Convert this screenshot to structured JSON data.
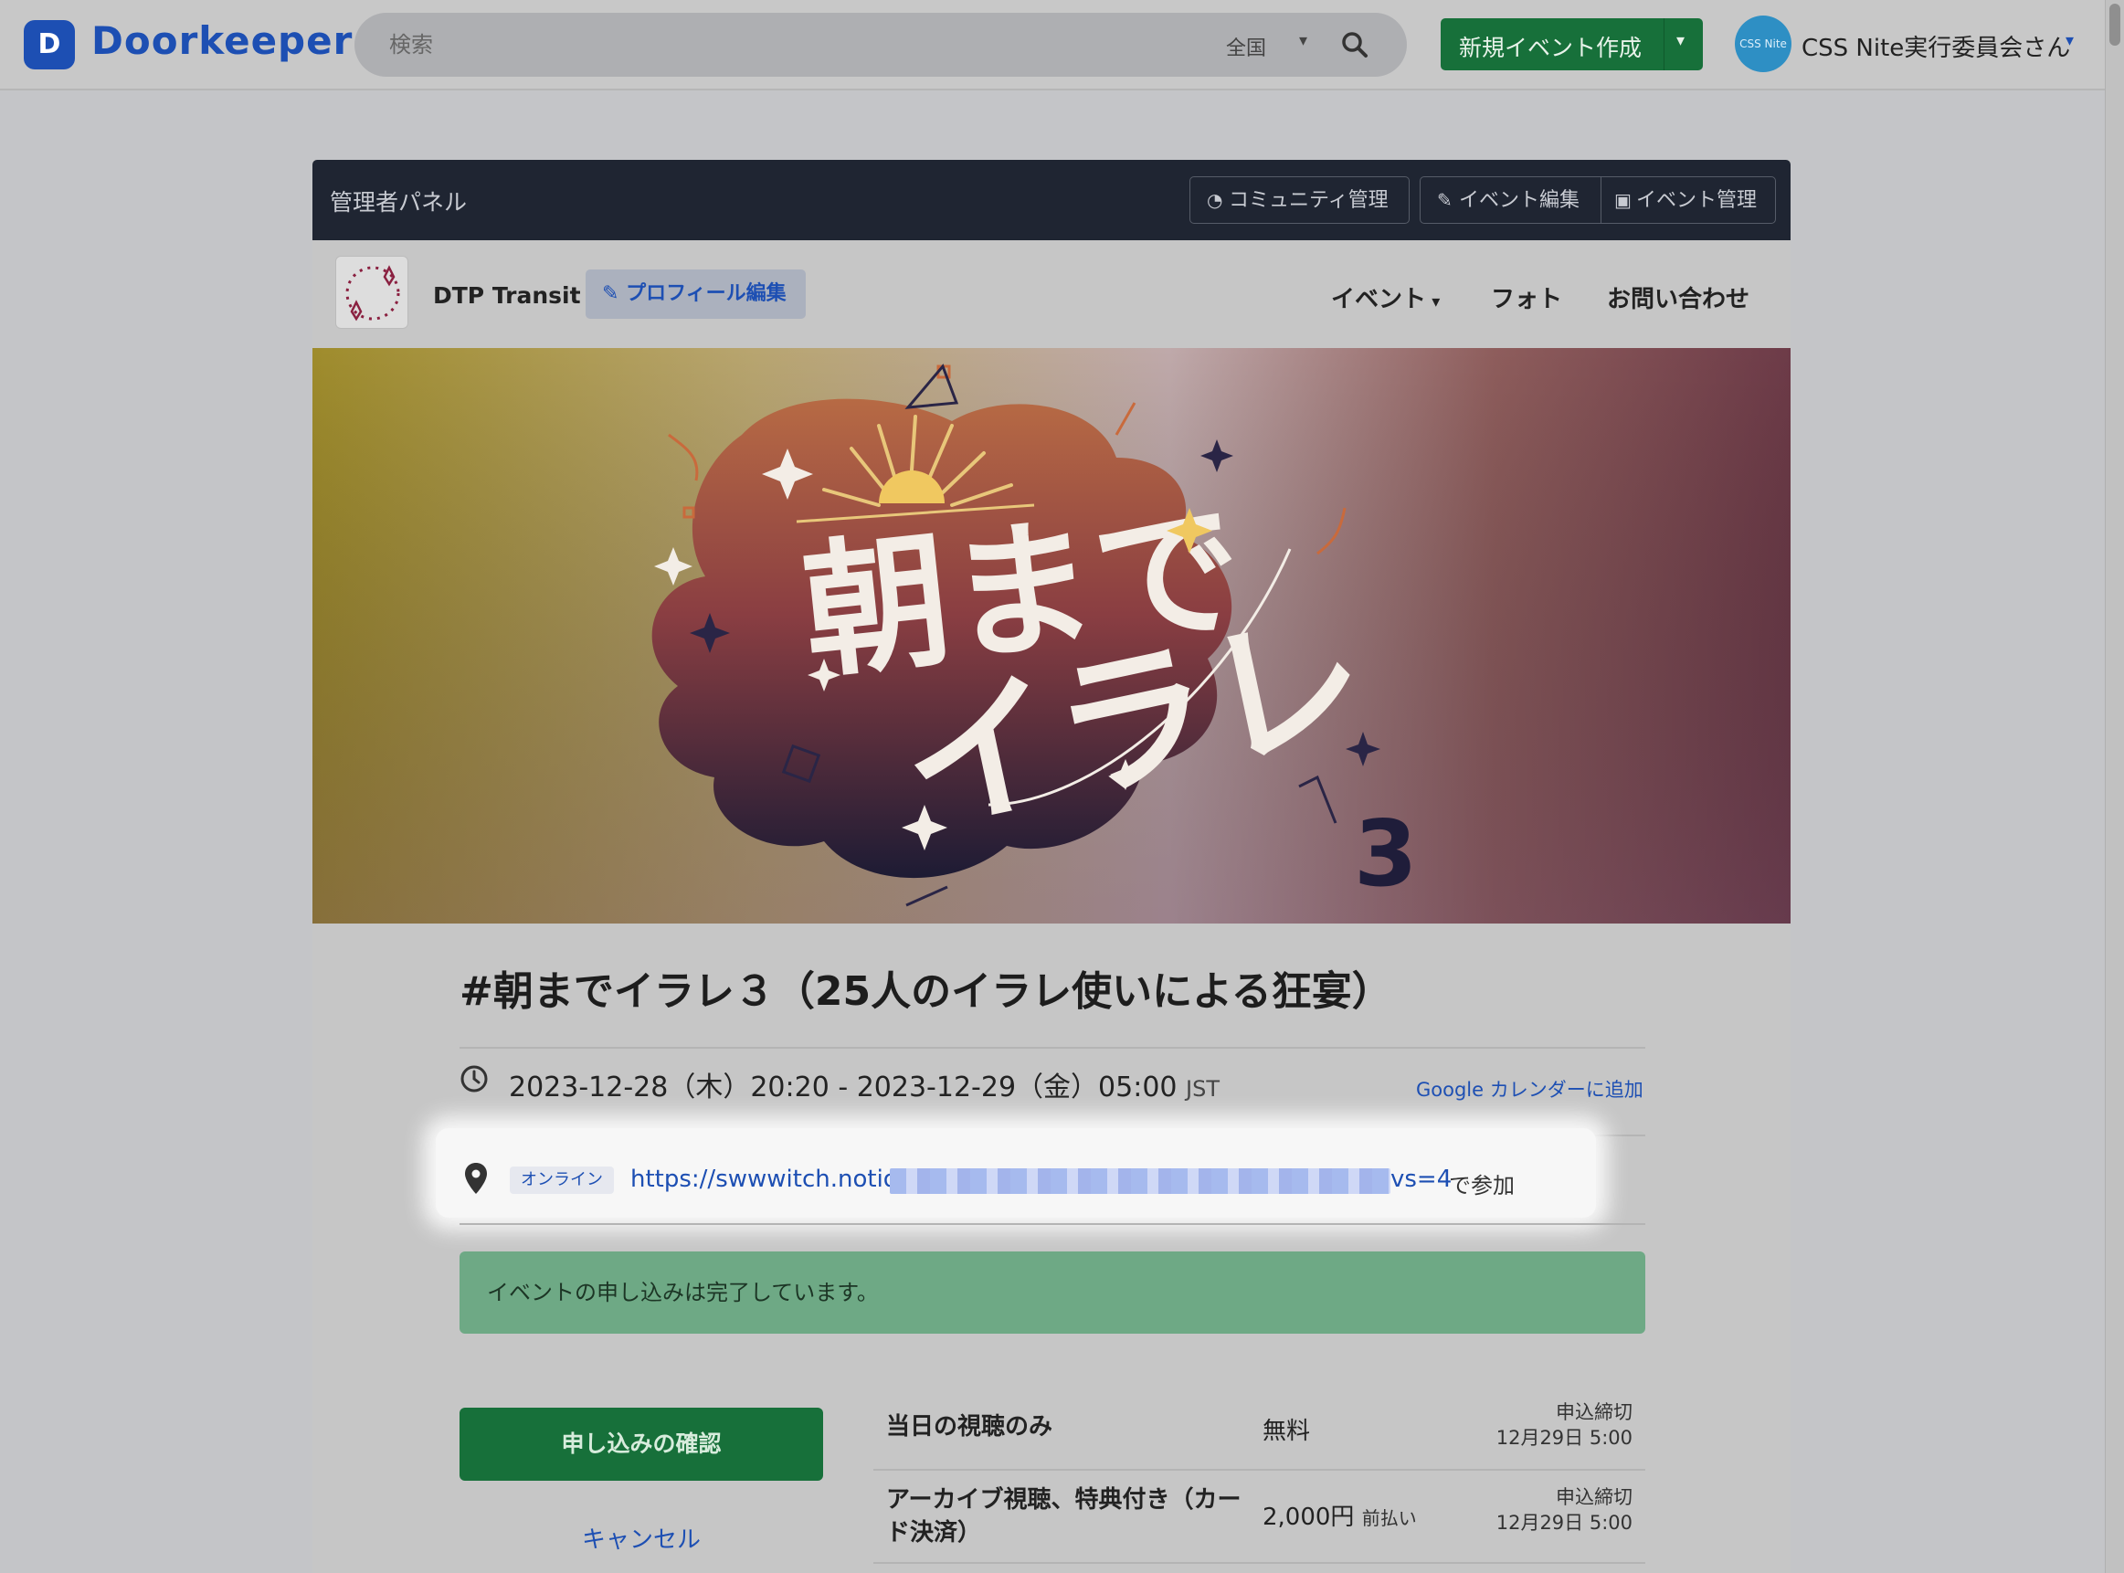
{
  "nav": {
    "logo_mark": "D",
    "logo_text": "Doorkeeper",
    "search_placeholder": "検索",
    "region": "全国",
    "new_event": "新規イベント作成",
    "user_avatar": "CSS Nite",
    "user_name": "CSS Nite実行委員会さん"
  },
  "admin": {
    "title": "管理者パネル",
    "community_manage": "コミュニティ管理",
    "event_edit": "イベント編集",
    "event_manage": "イベント管理"
  },
  "community": {
    "name": "DTP Transit",
    "profile_edit": "プロフィール編集",
    "menu": [
      "イベント",
      "フォト",
      "お問い合わせ"
    ]
  },
  "banner": {
    "line1": "朝まで",
    "line2": "イラレ",
    "number": "3"
  },
  "event": {
    "title": "#朝までイラレ３（25人のイラレ使いによる狂宴）",
    "datetime": "2023-12-28（木）20:20 - 2023-12-29（金）05:00",
    "timezone": "JST",
    "gcal": "Google カレンダーに追加",
    "online_badge": "オンライン",
    "link_start": "https://swwwitch.notion.",
    "link_end": "vs=4",
    "link_suffix": "で参加",
    "alert": "イベントの申し込みは完了しています。",
    "confirm": "申し込みの確認",
    "cancel": "キャンセル"
  },
  "tickets": [
    {
      "name": "当日の視聴のみ",
      "price": "無料",
      "payment": "",
      "deadline_label": "申込締切",
      "deadline": "12月29日 5:00"
    },
    {
      "name": "アーカイブ視聴、特典付き（カード決済）",
      "price": "2,000円",
      "payment": "前払い",
      "deadline_label": "申込締切",
      "deadline": "12月29日 5:00"
    }
  ],
  "colors": {
    "brand": "#1d4fb3",
    "primary_green": "#17703a",
    "admin_bar": "#1f2532",
    "alert_bg": "#6ea985"
  }
}
